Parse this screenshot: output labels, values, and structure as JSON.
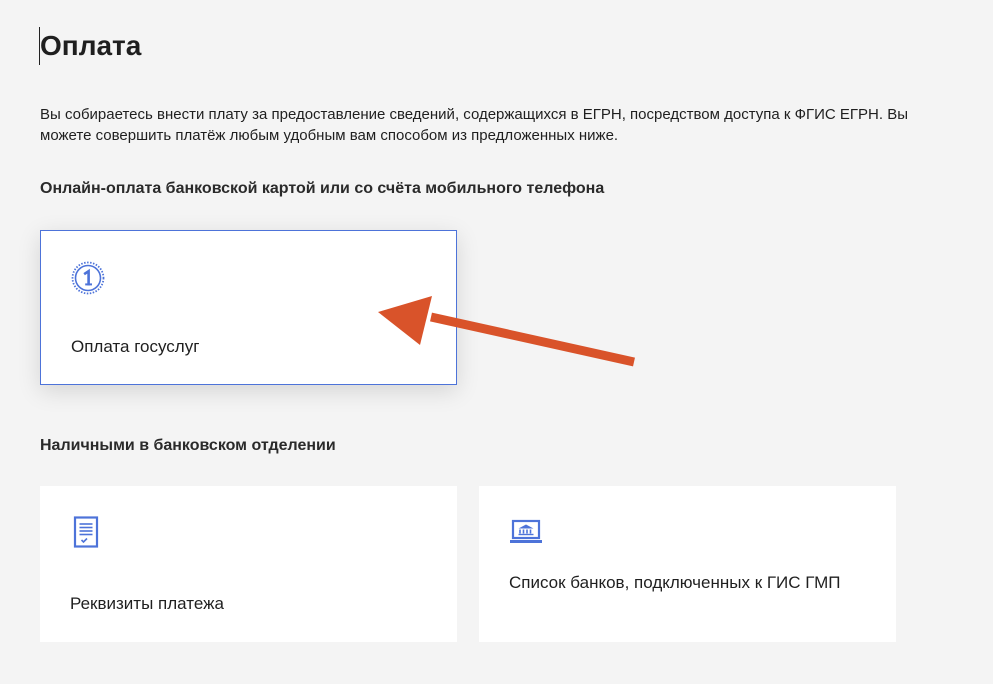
{
  "page": {
    "title": "Оплата",
    "intro": "Вы собираетесь внести плату за предоставление сведений, содержащихся в ЕГРН, посредством доступа к ФГИС ЕГРН. Вы можете совершить платёж любым удобным вам способом из предложенных ниже."
  },
  "online_section": {
    "title": "Онлайн-оплата банковской картой или со счёта мобильного телефона",
    "cards": [
      {
        "label": "Оплата госуслуг",
        "icon": "gosuslugi-coin-icon"
      }
    ]
  },
  "cash_section": {
    "title": "Наличными в банковском отделении",
    "cards": [
      {
        "label": "Реквизиты платежа",
        "icon": "document-icon"
      },
      {
        "label": "Список банков, подключенных к ГИС ГМП",
        "icon": "bank-laptop-icon"
      }
    ]
  },
  "colors": {
    "accent": "#4d73d9",
    "arrow": "#d9532a",
    "background": "#f4f4f4"
  }
}
